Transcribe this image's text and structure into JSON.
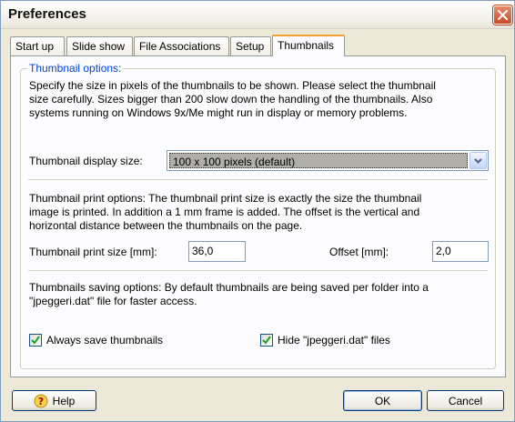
{
  "window": {
    "title": "Preferences"
  },
  "tabs": [
    {
      "label": "Start up"
    },
    {
      "label": "Slide show"
    },
    {
      "label": "File Associations"
    },
    {
      "label": "Setup"
    },
    {
      "label": "Thumbnails",
      "active": true
    }
  ],
  "thumbnail_options": {
    "group_title": "Thumbnail options:",
    "description_lines": [
      "Specify the size in pixels of the thumbnails to be shown. Please select the thumbnail",
      "size carefully. Sizes bigger than 200 slow down the handling of the thumbnails. Also",
      "systems running on Windows 9x/Me might run in display or memory problems."
    ],
    "display_size_label": "Thumbnail display size:",
    "display_size_value": "100 x 100 pixels (default)",
    "print_lines": [
      "Thumbnail print options:  The thumbnail print size is exactly the size the thumbnail",
      "image is printed. In addition a 1 mm frame is added. The offset is the vertical and",
      "horizontal distance between the thumbnails on the page."
    ],
    "print_size_label": "Thumbnail print size [mm]:",
    "print_size_value": "36,0",
    "offset_label": "Offset [mm]:",
    "offset_value": "2,0",
    "saving_lines": [
      "Thumbnails saving options: By default thumbnails are being saved per folder into a",
      "\"jpeggeri.dat\" file for faster access."
    ],
    "always_save_label": "Always save thumbnails",
    "always_save_checked": true,
    "hide_dat_label": "Hide \"jpeggeri.dat\" files",
    "hide_dat_checked": true
  },
  "buttons": {
    "help": "Help",
    "ok": "OK",
    "cancel": "Cancel"
  },
  "colors": {
    "accent_blue": "#0046d5",
    "close_red": "#c94a26",
    "tab_highlight": "#f0a030",
    "check_green": "#21a121"
  }
}
